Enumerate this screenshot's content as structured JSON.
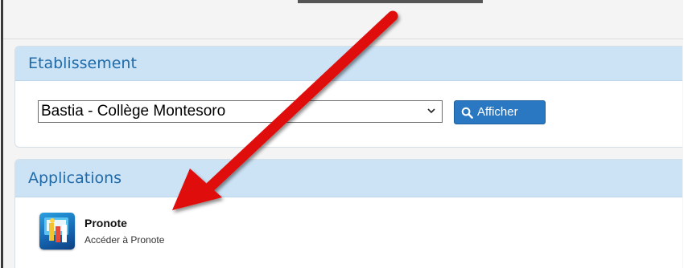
{
  "etablissement": {
    "title": "Etablissement",
    "selected": "Bastia - Collège Montesoro",
    "button_label": "Afficher"
  },
  "applications": {
    "title": "Applications",
    "items": [
      {
        "name": "Pronote",
        "description": "Accéder à Pronote"
      }
    ]
  },
  "colors": {
    "header_bg": "#cce3f6",
    "header_text": "#1f6aa8",
    "button_bg": "#2a78c2",
    "arrow": "#e01010"
  },
  "icons": {
    "button": "search-icon",
    "select": "chevron-down-icon",
    "app": "pronote-logo-icon"
  }
}
